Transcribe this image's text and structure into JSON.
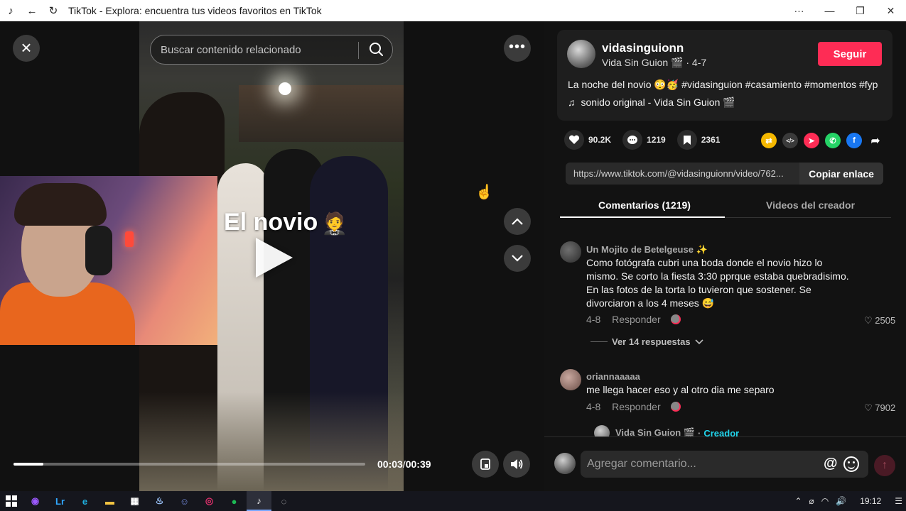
{
  "window": {
    "title": "TikTok - Explora: encuentra tus videos favoritos en TikTok",
    "controls": {
      "more": "···",
      "minimize": "—",
      "restore": "❐",
      "close": "✕"
    }
  },
  "video": {
    "search_placeholder": "Buscar contenido relacionado",
    "overlay_text": "El novio",
    "overlay_emoji": "🤵",
    "time_current": "00:03",
    "time_total": "00:39",
    "progress_fraction": 0.085
  },
  "creator": {
    "username": "vidasinguionn",
    "display_name": "Vida Sin Guion",
    "display_badge": "🎬",
    "date": "4-7",
    "follow_label": "Seguir"
  },
  "post": {
    "description": "La noche del novio 😳🥳 #vidasinguion #casamiento #momentos #fyp",
    "sound": "sonido original - Vida Sin Guion 🎬",
    "sound_icon": "♫"
  },
  "stats": {
    "likes": "90.2K",
    "comments": "1219",
    "saves": "2361"
  },
  "share": {
    "url": "https://www.tiktok.com/@vidasinguionn/video/762...",
    "copy_label": "Copiar enlace",
    "icons": [
      {
        "name": "repost-icon",
        "glyph": "⇄",
        "color": "#f5b800"
      },
      {
        "name": "embed-icon",
        "glyph": "</>",
        "color": "#3a3a3a"
      },
      {
        "name": "send-friends-icon",
        "glyph": "➤",
        "color": "#fe2c55"
      },
      {
        "name": "whatsapp-icon",
        "glyph": "✆",
        "color": "#25d366"
      },
      {
        "name": "facebook-icon",
        "glyph": "f",
        "color": "#1877f2"
      },
      {
        "name": "more-share-icon",
        "glyph": "➦",
        "color": "#121212"
      }
    ]
  },
  "tabs": {
    "comments": "Comentarios (1219)",
    "creator_videos": "Videos del creador"
  },
  "comments": [
    {
      "name": "Un Mojito de Betelgeuse",
      "name_suffix": "✨",
      "text": "Como fotógrafa cubri una boda donde el novio hizo lo mismo. Se corto la fiesta 3:30 pprque estaba quebradisimo. En las fotos de la torta lo tuvieron que sostener. Se divorciaron a los 4 meses 😅",
      "date": "4-8",
      "reply_label": "Responder",
      "likes": "2505",
      "avatar_color": "#4a4a4a"
    },
    {
      "name": "oriannaaaaa",
      "text": "me llega hacer eso y al otro dia me separo",
      "date": "4-8",
      "reply_label": "Responder",
      "likes": "7902",
      "avatar_color": "#8a6e66"
    }
  ],
  "replies_toggle": "Ver 14 respuestas",
  "creator_reply": {
    "name": "Vida Sin Guion 🎬",
    "separator": "·",
    "badge": "Creador"
  },
  "composer": {
    "placeholder": "Agregar comentario...",
    "at_symbol": "@",
    "send_glyph": "↑"
  },
  "taskbar": {
    "apps": [
      {
        "name": "taskbar-app-1-icon",
        "glyph": "◉",
        "color": "#9b59ff"
      },
      {
        "name": "lightroom-icon",
        "glyph": "Lr",
        "color": "#31a8ff"
      },
      {
        "name": "edge-icon",
        "glyph": "e",
        "color": "#1fb0e0"
      },
      {
        "name": "file-explorer-icon",
        "glyph": "▬",
        "color": "#f4c542"
      },
      {
        "name": "store-icon",
        "glyph": "▦",
        "color": "#ffffff"
      },
      {
        "name": "steam-icon",
        "glyph": "♨",
        "color": "#9ec7ff"
      },
      {
        "name": "discord-icon",
        "glyph": "☺",
        "color": "#7289da"
      },
      {
        "name": "instagram-icon",
        "glyph": "◎",
        "color": "#e1306c"
      },
      {
        "name": "spotify-icon",
        "glyph": "●",
        "color": "#1db954"
      },
      {
        "name": "tiktok-taskbar-icon",
        "glyph": "♪",
        "color": "#ffffff"
      },
      {
        "name": "obs-icon",
        "glyph": "◌",
        "color": "#cccccc"
      }
    ],
    "active_index": 9,
    "clock": "19:12",
    "tray": {
      "chevron": "⌃",
      "network_off": "⌀",
      "wifi": "◠",
      "volume": "🔊",
      "notifications": "☰"
    }
  },
  "colors": {
    "accent": "#fe2c55",
    "background": "#121212",
    "card": "#1e1e1e",
    "creator_badge": "#20d5ec"
  }
}
